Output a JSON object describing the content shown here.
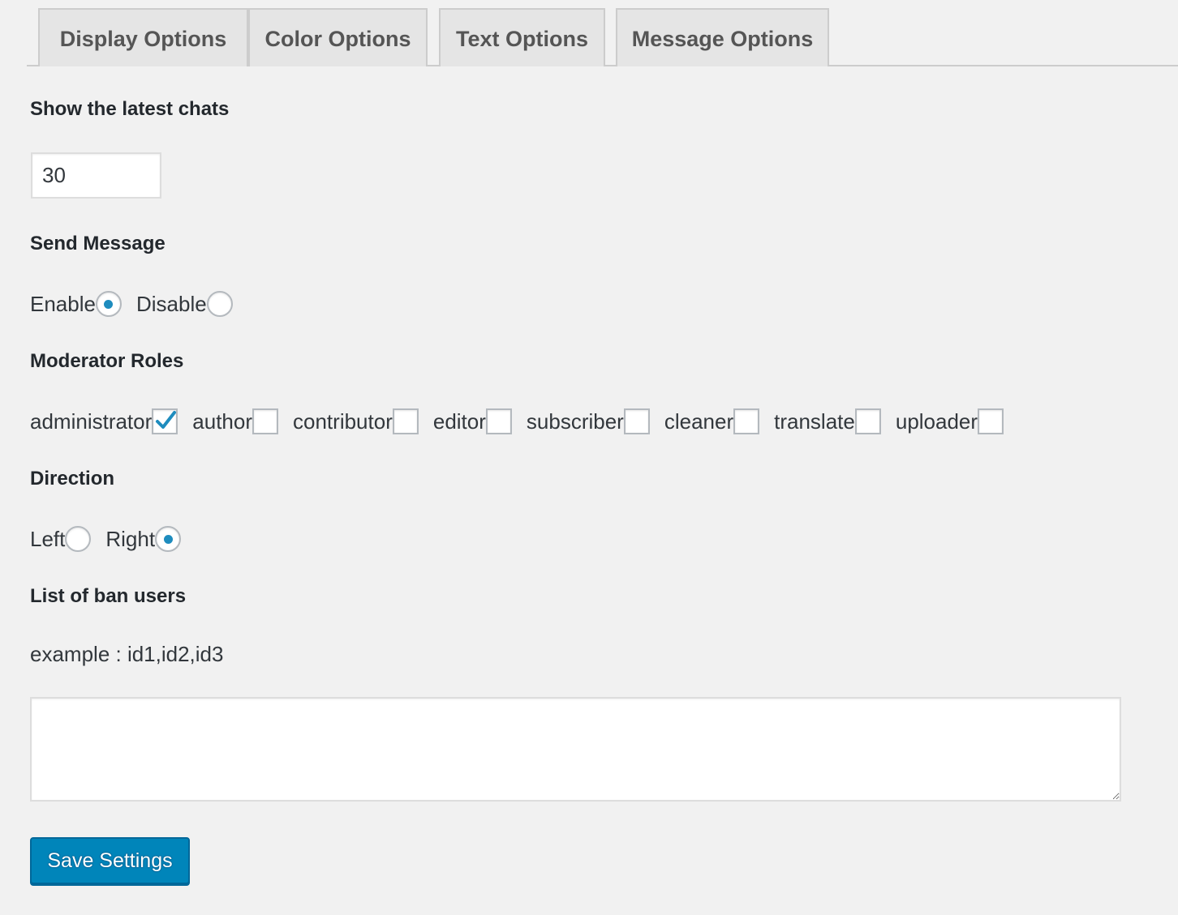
{
  "tabs": [
    {
      "label": "Display Options"
    },
    {
      "label": "Color Options"
    },
    {
      "label": "Text Options"
    },
    {
      "label": "Message Options"
    }
  ],
  "latest_chats": {
    "heading": "Show the latest chats",
    "value": "30"
  },
  "send_message": {
    "heading": "Send Message",
    "options": [
      {
        "label": "Enable",
        "checked": true
      },
      {
        "label": "Disable",
        "checked": false
      }
    ]
  },
  "moderator_roles": {
    "heading": "Moderator Roles",
    "roles": [
      {
        "label": "administrator",
        "checked": true
      },
      {
        "label": "author",
        "checked": false
      },
      {
        "label": "contributor",
        "checked": false
      },
      {
        "label": "editor",
        "checked": false
      },
      {
        "label": "subscriber",
        "checked": false
      },
      {
        "label": "cleaner",
        "checked": false
      },
      {
        "label": "translate",
        "checked": false
      },
      {
        "label": "uploader",
        "checked": false
      }
    ]
  },
  "direction": {
    "heading": "Direction",
    "options": [
      {
        "label": "Left",
        "checked": false
      },
      {
        "label": "Right",
        "checked": true
      }
    ]
  },
  "ban_users": {
    "heading": "List of ban users",
    "hint": "example : id1,id2,id3",
    "value": ""
  },
  "save_button": {
    "label": "Save Settings"
  },
  "colors": {
    "accent": "#0085ba",
    "radio_dot": "#1e8cbe",
    "checkmark": "#1e8cbe",
    "background": "#f1f1f1"
  }
}
